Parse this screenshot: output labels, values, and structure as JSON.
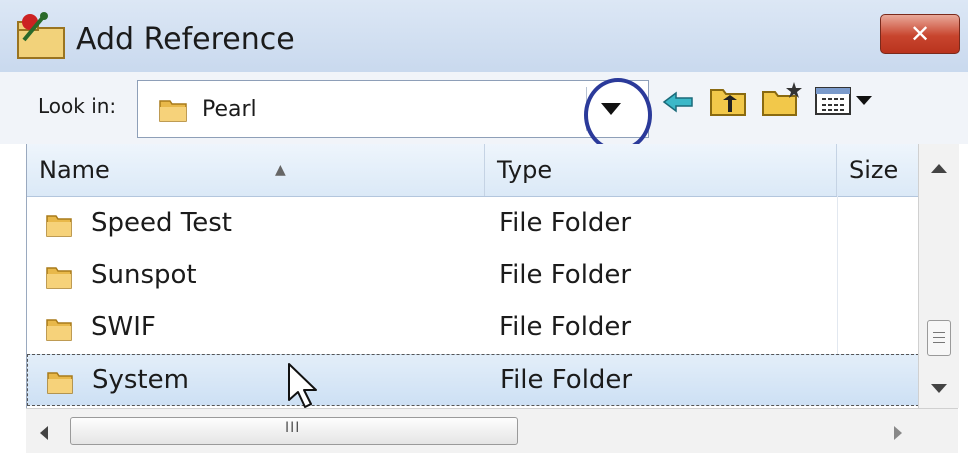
{
  "window": {
    "title": "Add Reference",
    "close_label": "✕",
    "icon": "add-reference-app-icon"
  },
  "lookin": {
    "label": "Look in:",
    "value": "Pearl"
  },
  "toolbar": {
    "icons": [
      "back-icon",
      "up-folder-icon",
      "new-folder-icon",
      "view-menu-icon"
    ]
  },
  "columns": {
    "name": "Name",
    "type": "Type",
    "size": "Size"
  },
  "rows": [
    {
      "name": "Speed Test",
      "type": "File Folder"
    },
    {
      "name": "Sunspot",
      "type": "File Folder"
    },
    {
      "name": "SWIF",
      "type": "File Folder"
    },
    {
      "name": "System",
      "type": "File Folder"
    }
  ],
  "scrollbar": {
    "h_grip": "III"
  },
  "colors": {
    "highlight_ring": "#2b3a9a",
    "selection": "#cde0f4",
    "close_button": "#c8452e",
    "folder": "#e8b84a"
  }
}
